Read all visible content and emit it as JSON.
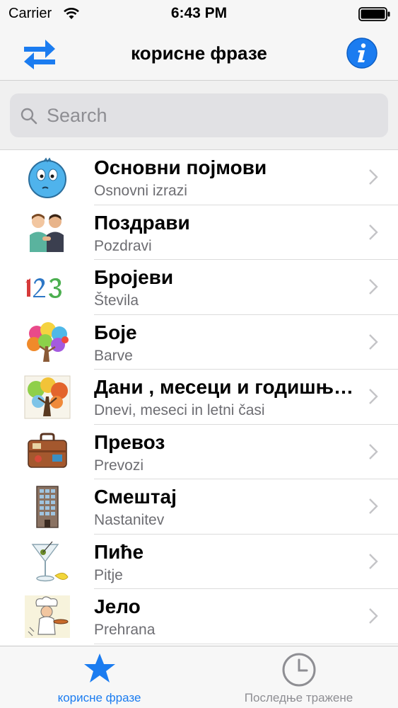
{
  "status_bar": {
    "carrier": "Carrier",
    "time": "6:43 PM"
  },
  "nav": {
    "title": "корисне фразе",
    "left_icon": "swap-arrows-icon",
    "right_icon": "info-icon",
    "accent": "#1b7cf0"
  },
  "search": {
    "placeholder": "Search",
    "value": ""
  },
  "list": [
    {
      "title": "Основни појмови",
      "subtitle": "Osnovni izrazi",
      "icon": "smiley-face-icon"
    },
    {
      "title": "Поздрави",
      "subtitle": "Pozdravi",
      "icon": "greeting-people-icon"
    },
    {
      "title": "Бројеви",
      "subtitle": "Števila",
      "icon": "numbers-icon"
    },
    {
      "title": "Боје",
      "subtitle": "Barve",
      "icon": "colorful-tree-icon"
    },
    {
      "title": "Дани , месеци и годишња доба",
      "subtitle": "Dnevi, meseci in letni časi",
      "icon": "seasons-tree-icon"
    },
    {
      "title": "Превоз",
      "subtitle": "Prevozi",
      "icon": "suitcase-icon"
    },
    {
      "title": "Смештај",
      "subtitle": "Nastanitev",
      "icon": "hotel-building-icon"
    },
    {
      "title": "Пиће",
      "subtitle": "Pitje",
      "icon": "cocktail-glass-icon"
    },
    {
      "title": "Јело",
      "subtitle": "Prehrana",
      "icon": "chef-icon"
    }
  ],
  "tabs": [
    {
      "label": "корисне фразе",
      "icon": "star-icon",
      "active": true
    },
    {
      "label": "Последње тражене",
      "icon": "clock-icon",
      "active": false
    }
  ]
}
